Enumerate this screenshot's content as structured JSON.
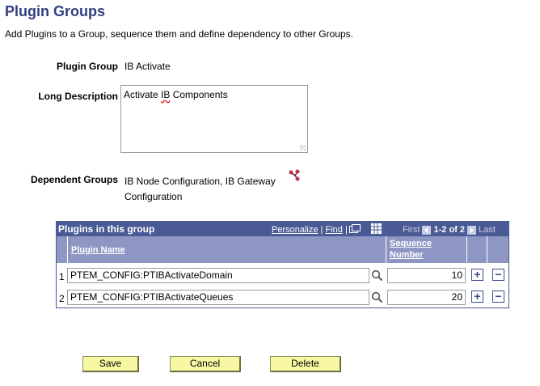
{
  "page": {
    "title": "Plugin Groups",
    "instructions": "Add Plugins to a Group, sequence them and define dependency to other Groups."
  },
  "form": {
    "plugin_group_label": "Plugin Group",
    "plugin_group_value": "IB Activate",
    "long_description_label": "Long Description",
    "long_description_pre": "Activate ",
    "long_description_spell": "IB",
    "long_description_post": " Components",
    "dependent_groups_label": "Dependent Groups",
    "dependent_groups_line1": "IB Node Configuration, IB Gateway",
    "dependent_groups_line2": "Configuration",
    "dependent_icon": "hierarchy-icon"
  },
  "grid": {
    "title": "Plugins in this group",
    "personalize": "Personalize",
    "sep": "|",
    "find": "Find",
    "first": "First",
    "range": "1-2 of 2",
    "last": "Last",
    "col_plugin": "Plugin Name",
    "col_seq_1": "Sequence",
    "col_seq_2": "Number",
    "rows": [
      {
        "num": "1",
        "plugin": "PTEM_CONFIG:PTIBActivateDomain",
        "seq": "10"
      },
      {
        "num": "2",
        "plugin": "PTEM_CONFIG:PTIBActivateQueues",
        "seq": "20"
      }
    ],
    "add": "+",
    "remove": "−"
  },
  "buttons": {
    "save": "Save",
    "cancel": "Cancel",
    "delete": "Delete"
  },
  "colors": {
    "title": "#2f3f7f",
    "grid_header": "#4a5a94",
    "col_header": "#8e96c3",
    "button": "#f8f8a4"
  }
}
